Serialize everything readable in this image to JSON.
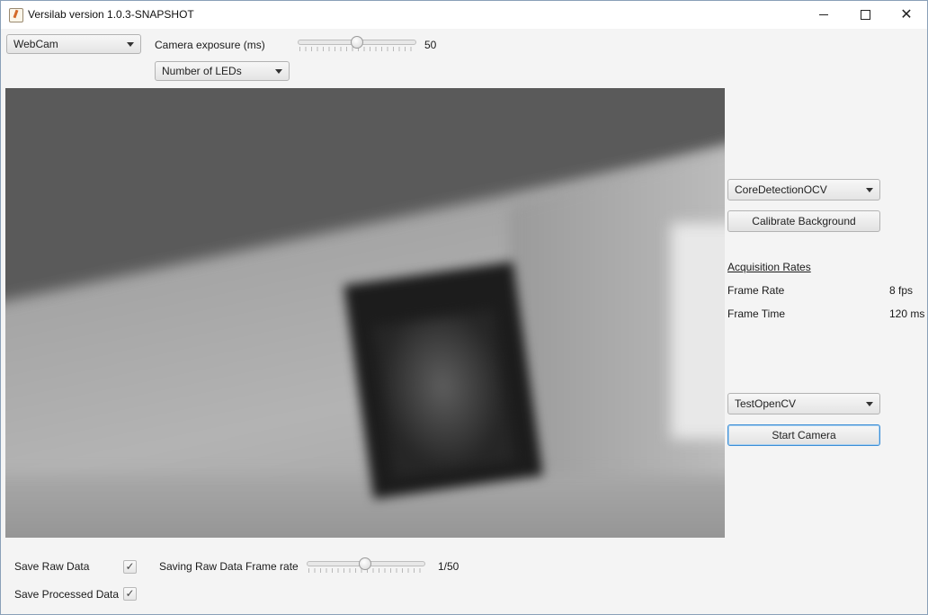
{
  "window": {
    "title": "Versilab version 1.0.3-SNAPSHOT"
  },
  "top_controls": {
    "source_select": "WebCam",
    "exposure_label": "Camera exposure (ms)",
    "exposure_value_text": "50",
    "exposure_value": 50,
    "exposure_slider_fraction": 0.5,
    "led_select": "Number of LEDs"
  },
  "side_panel": {
    "detection_select": "CoreDetectionOCV",
    "calibrate_button": "Calibrate Background",
    "rates_heading": "Acquisition Rates",
    "frame_rate_label": "Frame Rate",
    "frame_rate_value": "8 fps",
    "frame_time_label": "Frame Time",
    "frame_time_value": "120 ms",
    "test_select": "TestOpenCV",
    "start_button": "Start Camera"
  },
  "bottom_controls": {
    "save_raw_label": "Save Raw Data",
    "save_raw_checked": true,
    "raw_rate_label": "Saving Raw Data Frame rate",
    "raw_rate_value_text": "1/50",
    "raw_rate_slider_fraction": 0.49,
    "save_processed_label": "Save Processed Data",
    "save_processed_checked": true
  },
  "icons": {
    "app": "java-cup-icon",
    "minimize": "minimize-icon",
    "maximize": "maximize-icon",
    "close": "close-icon",
    "dropdown": "chevron-down-icon",
    "check": "check-icon"
  }
}
